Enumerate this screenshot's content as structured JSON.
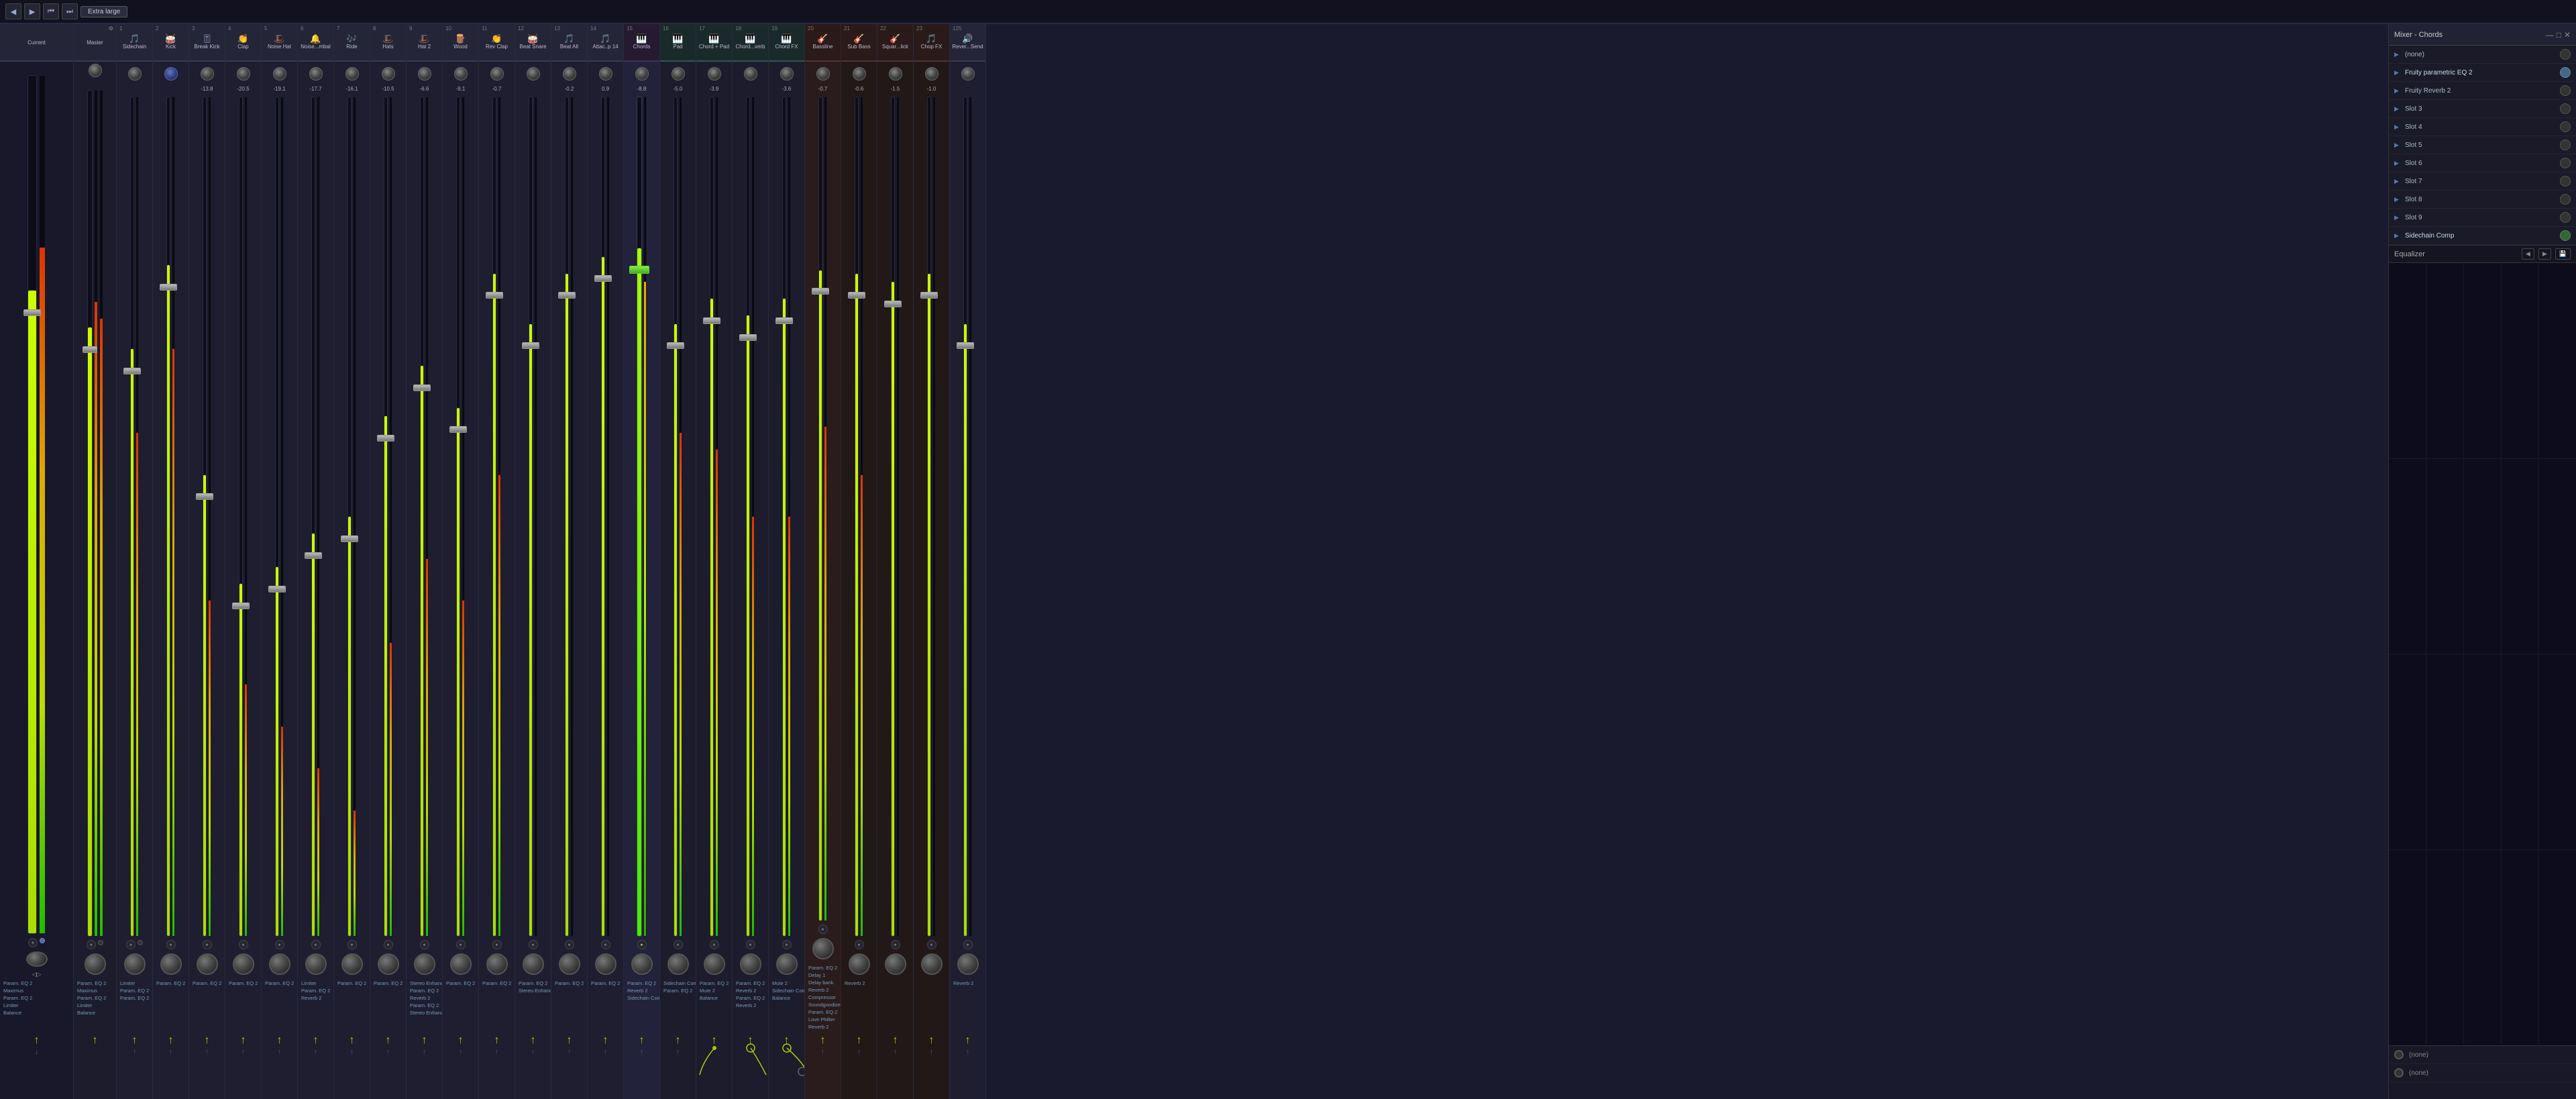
{
  "toolbar": {
    "title": "Mixer",
    "size_label": "Extra large",
    "buttons": [
      "◀",
      "▶",
      "⏮",
      "⏭"
    ]
  },
  "channels": [
    {
      "id": "current",
      "num": "",
      "name": "Current",
      "type": "current",
      "db": "",
      "fx": []
    },
    {
      "id": "master",
      "num": "",
      "name": "Master",
      "type": "master",
      "db": "",
      "fx": [
        "Param. EQ 2",
        "Maximus",
        "Param. EQ 2",
        "Limiter",
        "Balance"
      ]
    },
    {
      "id": "ch1",
      "num": "1",
      "name": "Sidechain",
      "type": "normal",
      "db": "",
      "fx": [
        "Limiter",
        "Param. EQ 2",
        "Param. EQ 2"
      ]
    },
    {
      "id": "ch2",
      "num": "2",
      "name": "Kick",
      "type": "normal",
      "db": "",
      "fx": [
        "Param. EQ 2"
      ]
    },
    {
      "id": "ch3",
      "num": "3",
      "name": "Break Kick",
      "type": "normal",
      "db": "-13.8",
      "fx": [
        "Param. EQ 2"
      ]
    },
    {
      "id": "ch4",
      "num": "4",
      "name": "Clap",
      "type": "normal",
      "db": "-20.5",
      "fx": [
        "Param. EQ 2"
      ]
    },
    {
      "id": "ch5",
      "num": "5",
      "name": "Noise Hat",
      "type": "normal",
      "db": "-19.1",
      "fx": [
        "Param. EQ 2"
      ]
    },
    {
      "id": "ch6",
      "num": "6",
      "name": "Noise...mbal",
      "type": "normal",
      "db": "-17.7",
      "fx": [
        "Limiter",
        "Param. EQ 2",
        "Reverb 2"
      ]
    },
    {
      "id": "ch7",
      "num": "7",
      "name": "Ride",
      "type": "normal",
      "db": "-16.1",
      "fx": [
        "Param. EQ 2"
      ]
    },
    {
      "id": "ch8",
      "num": "8",
      "name": "Hats",
      "type": "normal",
      "db": "-10.5",
      "fx": [
        "Param. EQ 2"
      ]
    },
    {
      "id": "ch9",
      "num": "9",
      "name": "Hat 2",
      "type": "normal",
      "db": "-6.6",
      "fx": [
        "Stereo Enhancer",
        "Param. EQ 2",
        "Reverb 2",
        "Param. EQ 2",
        "Stereo Enhancer"
      ]
    },
    {
      "id": "ch10",
      "num": "10",
      "name": "Wood",
      "type": "normal",
      "db": "-9.1",
      "fx": [
        "Param. EQ 2"
      ]
    },
    {
      "id": "ch11",
      "num": "11",
      "name": "Rev Clap",
      "type": "normal",
      "db": "-0.7",
      "fx": [
        "Param. EQ 2"
      ]
    },
    {
      "id": "ch12",
      "num": "12",
      "name": "Beat Snare",
      "type": "normal",
      "db": "",
      "fx": [
        "Param. EQ 2"
      ]
    },
    {
      "id": "ch13",
      "num": "13",
      "name": "Beat All",
      "type": "normal",
      "db": "-0.2",
      "fx": [
        "Param. EQ 2"
      ]
    },
    {
      "id": "ch14",
      "num": "14",
      "name": "Attac..p 14",
      "type": "normal",
      "db": "0.9",
      "fx": [
        "Param. EQ 2"
      ]
    },
    {
      "id": "ch15",
      "num": "15",
      "name": "Chords",
      "type": "chords",
      "db": "-8.8",
      "fx": [
        "Param. EQ 2",
        "Reverb 2",
        "Sidechain Comp"
      ]
    },
    {
      "id": "ch16",
      "num": "16",
      "name": "Pad",
      "type": "chords",
      "db": "-5.0",
      "fx": [
        "Sidechain Comp",
        "Param. EQ 2"
      ]
    },
    {
      "id": "ch17",
      "num": "17",
      "name": "Chord + Pad",
      "type": "chords",
      "db": "-3.9",
      "fx": [
        "Param. EQ 2",
        "Mute 2",
        "Balance"
      ]
    },
    {
      "id": "ch18",
      "num": "18",
      "name": "Chord...verb",
      "type": "chords",
      "db": "",
      "fx": [
        "Param. EQ 2",
        "Reverb 2",
        "Param. EQ 2",
        "Reverb 2"
      ]
    },
    {
      "id": "ch19",
      "num": "19",
      "name": "Chord FX",
      "type": "chords",
      "db": "-3.6",
      "fx": [
        "Mute 2",
        "Sidechain Comp",
        "Balance"
      ]
    },
    {
      "id": "ch20",
      "num": "20",
      "name": "Bassline",
      "type": "bass",
      "db": "-0.7",
      "fx": [
        "Param. EQ 2",
        "Delay 1",
        "Delay Bank",
        "Reverb 2",
        "Compressor",
        "Soundgoodizer",
        "Param. EQ 2",
        "Love Philter",
        "Reverb 2"
      ]
    },
    {
      "id": "ch21",
      "num": "21",
      "name": "Sub Bass",
      "type": "bass",
      "db": "-0.6",
      "fx": [
        "Reverb 2"
      ]
    },
    {
      "id": "ch22",
      "num": "22",
      "name": "Squar...lick",
      "type": "bass",
      "db": "-1.5",
      "fx": []
    },
    {
      "id": "ch23",
      "num": "23",
      "name": "Chop FX",
      "type": "bass",
      "db": "-1.0",
      "fx": []
    },
    {
      "id": "ch125",
      "num": "125",
      "name": "Rever...Send",
      "type": "normal",
      "db": "",
      "fx": [
        "Reverb 2"
      ]
    }
  ],
  "right_panel": {
    "title": "Mixer - Chords",
    "slots": [
      {
        "label": "(none)",
        "active": false,
        "toggle": false
      },
      {
        "label": "Fruity parametric EQ 2",
        "active": true,
        "toggle": true
      },
      {
        "label": "Fruity Reverb 2",
        "active": true,
        "toggle": false
      },
      {
        "label": "Slot 3",
        "active": false,
        "toggle": false
      },
      {
        "label": "Slot 4",
        "active": false,
        "toggle": false
      },
      {
        "label": "Slot 5",
        "active": false,
        "toggle": false
      },
      {
        "label": "Slot 6",
        "active": false,
        "toggle": false
      },
      {
        "label": "Slot 7",
        "active": false,
        "toggle": false
      },
      {
        "label": "Slot 8",
        "active": false,
        "toggle": false
      },
      {
        "label": "Slot 9",
        "active": false,
        "toggle": false
      },
      {
        "label": "Sidechain Comp",
        "active": true,
        "toggle": true
      }
    ],
    "eq_label": "Equalizer",
    "routing": [
      {
        "label": "(none)",
        "indicator": false
      },
      {
        "label": "(none)",
        "indicator": false
      }
    ]
  }
}
